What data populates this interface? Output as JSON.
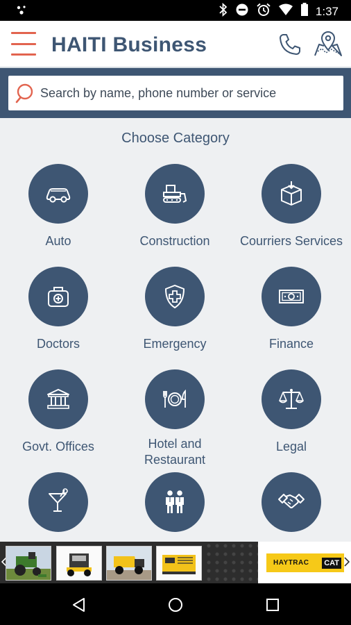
{
  "status_bar": {
    "time": "1:37",
    "icons": [
      "assistant-dots-icon",
      "bluetooth-icon",
      "do-not-disturb-icon",
      "alarm-icon",
      "wifi-icon",
      "battery-icon"
    ]
  },
  "app_bar": {
    "menu_icon": "hamburger-menu-icon",
    "title": "HAITI Business",
    "phone_icon": "phone-icon",
    "map_icon": "map-pin-icon"
  },
  "search": {
    "placeholder": "Search by name, phone number or service",
    "value": ""
  },
  "content": {
    "section_title": "Choose Category",
    "categories": [
      {
        "label": "Auto",
        "icon": "car-icon"
      },
      {
        "label": "Construction",
        "icon": "bulldozer-icon"
      },
      {
        "label": "Courriers Services",
        "icon": "package-icon"
      },
      {
        "label": "Doctors",
        "icon": "medical-kit-icon"
      },
      {
        "label": "Emergency",
        "icon": "shield-cross-icon"
      },
      {
        "label": "Finance",
        "icon": "banknote-icon"
      },
      {
        "label": "Govt. Offices",
        "icon": "government-building-icon"
      },
      {
        "label": "Hotel and Restaurant",
        "icon": "plate-cutlery-icon"
      },
      {
        "label": "Legal",
        "icon": "scales-icon"
      },
      {
        "label": "",
        "icon": "cocktail-icon"
      },
      {
        "label": "",
        "icon": "people-icon"
      },
      {
        "label": "",
        "icon": "handshake-icon"
      }
    ]
  },
  "ad_banner": {
    "brand_text": "HAYTRAC",
    "brand_mark": "CAT"
  },
  "nav_bar": {
    "icons": [
      "back-icon",
      "home-icon",
      "recents-icon"
    ]
  },
  "colors": {
    "primary": "#3e5673",
    "accent": "#e2644f",
    "background": "#eef0f2"
  }
}
